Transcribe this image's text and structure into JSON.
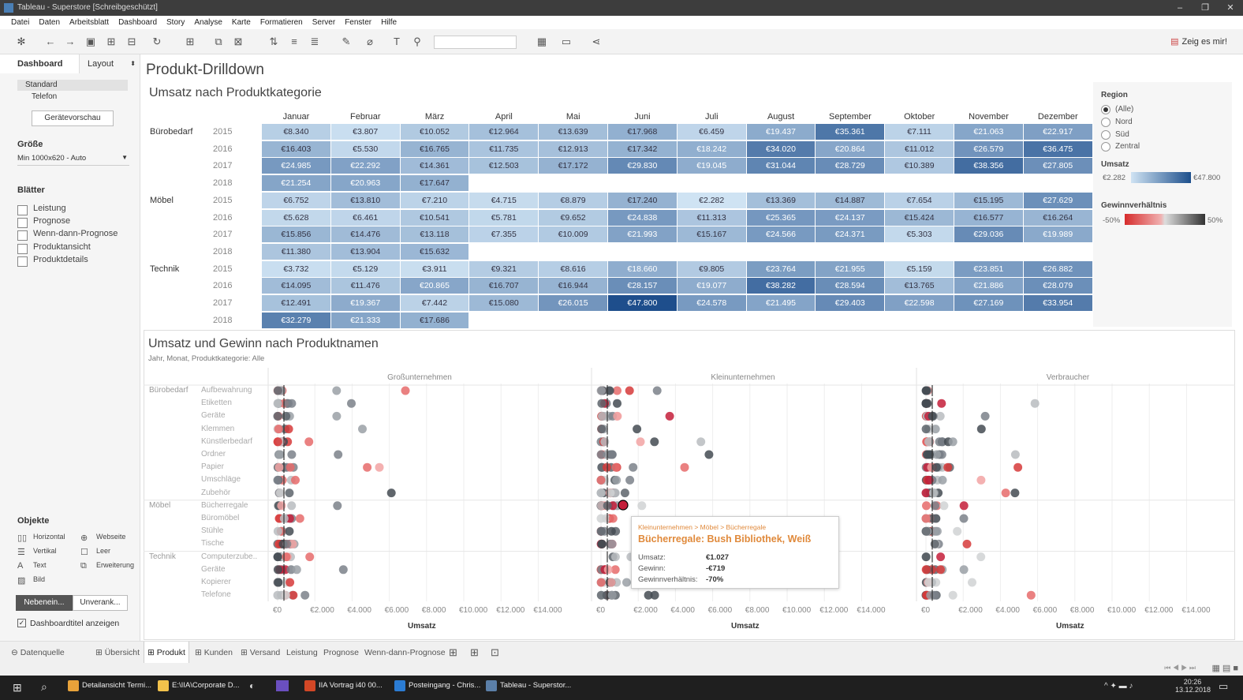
{
  "window": {
    "title": "Tableau - Superstore [Schreibgeschützt]"
  },
  "menu": [
    "Datei",
    "Daten",
    "Arbeitsblatt",
    "Dashboard",
    "Story",
    "Analyse",
    "Karte",
    "Formatieren",
    "Server",
    "Fenster",
    "Hilfe"
  ],
  "toolbar": {
    "show_me": "Zeig es mir!"
  },
  "left": {
    "tab_dashboard": "Dashboard",
    "tab_layout": "Layout",
    "devices": [
      "Standard",
      "Telefon"
    ],
    "preview_btn": "Gerätevorschau",
    "size_title": "Größe",
    "size_value": "Min 1000x620 - Auto",
    "sheets_title": "Blätter",
    "sheets": [
      "Leistung",
      "Prognose",
      "Wenn-dann-Prognose",
      "Produktansicht",
      "Produktdetails"
    ],
    "objects_title": "Objekte",
    "objects": [
      "Horizontal",
      "Webseite",
      "Vertikal",
      "Leer",
      "Text",
      "Erweiterung",
      "Bild"
    ],
    "tiled_btn": "Nebenein...",
    "floating_btn": "Unverank...",
    "show_title_label": "Dashboardtitel anzeigen"
  },
  "dashboard": {
    "title": "Produkt-Drilldown",
    "heatmap_title": "Umsatz nach Produktkategorie",
    "scatter_title": "Umsatz und Gewinn nach Produktnamen",
    "scatter_subtitle": "Jahr, Monat, Produktkategorie: Alle"
  },
  "chart_data": [
    {
      "type": "heatmap",
      "title": "Umsatz nach Produktkategorie",
      "months": [
        "Januar",
        "Februar",
        "März",
        "April",
        "Mai",
        "Juni",
        "Juli",
        "August",
        "September",
        "Oktober",
        "November",
        "Dezember"
      ],
      "rows": [
        {
          "category": "Bürobedarf",
          "year": "2015",
          "values": [
            "€8.340",
            "€3.807",
            "€10.052",
            "€12.964",
            "€13.639",
            "€17.968",
            "€6.459",
            "€19.437",
            "€35.361",
            "€7.111",
            "€21.063",
            "€22.917"
          ]
        },
        {
          "category": "",
          "year": "2016",
          "values": [
            "€16.403",
            "€5.530",
            "€16.765",
            "€11.735",
            "€12.913",
            "€17.342",
            "€18.242",
            "€34.020",
            "€20.864",
            "€11.012",
            "€26.579",
            "€36.475"
          ]
        },
        {
          "category": "",
          "year": "2017",
          "values": [
            "€24.985",
            "€22.292",
            "€14.361",
            "€12.503",
            "€17.172",
            "€29.830",
            "€19.045",
            "€31.044",
            "€28.729",
            "€10.389",
            "€38.356",
            "€27.805"
          ]
        },
        {
          "category": "",
          "year": "2018",
          "values": [
            "€21.254",
            "€20.963",
            "€17.647"
          ]
        },
        {
          "category": "Möbel",
          "year": "2015",
          "values": [
            "€6.752",
            "€13.810",
            "€7.210",
            "€4.715",
            "€8.879",
            "€17.240",
            "€2.282",
            "€13.369",
            "€14.887",
            "€7.654",
            "€15.195",
            "€27.629"
          ]
        },
        {
          "category": "",
          "year": "2016",
          "values": [
            "€5.628",
            "€6.461",
            "€10.541",
            "€5.781",
            "€9.652",
            "€24.838",
            "€11.313",
            "€25.365",
            "€24.137",
            "€15.424",
            "€16.577",
            "€16.264"
          ]
        },
        {
          "category": "",
          "year": "2017",
          "values": [
            "€15.856",
            "€14.476",
            "€13.118",
            "€7.355",
            "€10.009",
            "€21.993",
            "€15.167",
            "€24.566",
            "€24.371",
            "€5.303",
            "€29.036",
            "€19.989"
          ]
        },
        {
          "category": "",
          "year": "2018",
          "values": [
            "€11.380",
            "€13.904",
            "€15.632"
          ]
        },
        {
          "category": "Technik",
          "year": "2015",
          "values": [
            "€3.732",
            "€5.129",
            "€3.911",
            "€9.321",
            "€8.616",
            "€18.660",
            "€9.805",
            "€23.764",
            "€21.955",
            "€5.159",
            "€23.851",
            "€26.882"
          ]
        },
        {
          "category": "",
          "year": "2016",
          "values": [
            "€14.095",
            "€11.476",
            "€20.865",
            "€16.707",
            "€16.944",
            "€28.157",
            "€19.077",
            "€38.282",
            "€28.594",
            "€13.765",
            "€21.886",
            "€28.079"
          ]
        },
        {
          "category": "",
          "year": "2017",
          "values": [
            "€12.491",
            "€19.367",
            "€7.442",
            "€15.080",
            "€26.015",
            "€47.800",
            "€24.578",
            "€21.495",
            "€29.403",
            "€22.598",
            "€27.169",
            "€33.954"
          ]
        },
        {
          "category": "",
          "year": "2018",
          "values": [
            "€32.279",
            "€21.333",
            "€17.686"
          ]
        }
      ]
    },
    {
      "type": "scatter",
      "title": "Umsatz und Gewinn nach Produktnamen",
      "segments": [
        "Großunternehmen",
        "Kleinunternehmen",
        "Verbraucher"
      ],
      "categories": [
        {
          "name": "Bürobedarf",
          "subs": [
            "Aufbewahrung",
            "Etiketten",
            "Geräte",
            "Klemmen",
            "Künstlerbedarf",
            "Ordner",
            "Papier",
            "Umschläge",
            "Zubehör"
          ]
        },
        {
          "name": "Möbel",
          "subs": [
            "Bücherregale",
            "Büromöbel",
            "Stühle",
            "Tische"
          ]
        },
        {
          "name": "Technik",
          "subs": [
            "Computerzube..",
            "Geräte",
            "Kopierer",
            "Telefone"
          ]
        }
      ],
      "x_ticks": [
        "€0",
        "€2.000",
        "€4.000",
        "€6.000",
        "€8.000",
        "€10.000",
        "€12.000",
        "€14.000"
      ],
      "xlabel": "Umsatz"
    }
  ],
  "legend": {
    "region_title": "Region",
    "regions": [
      "(Alle)",
      "Nord",
      "Süd",
      "Zentral"
    ],
    "sales_title": "Umsatz",
    "sales_min": "€2.282",
    "sales_max": "€47.800",
    "profit_title": "Gewinnverhältnis",
    "profit_min": "-50%",
    "profit_max": "50%"
  },
  "tooltip": {
    "path": "Kleinunternehmen > Möbel > Bücherregale",
    "title": "Bücherregale: Bush Bibliothek, Weiß",
    "rows": [
      {
        "label": "Umsatz:",
        "value": "€1.027"
      },
      {
        "label": "Gewinn:",
        "value": "-€719"
      },
      {
        "label": "Gewinnverhältnis:",
        "value": "-70%"
      }
    ]
  },
  "tabs": {
    "datasource": "Datenquelle",
    "items": [
      "Übersicht",
      "Produkt",
      "Kunden",
      "Versand",
      "Leistung",
      "Prognose",
      "Wenn-dann-Prognose"
    ]
  },
  "taskbar": {
    "items": [
      "Detailansicht Termi...",
      "E:\\IIA\\Corporate D...",
      "IIA Vortrag i40 00...",
      "Posteingang - Chris...",
      "Tableau - Superstor..."
    ],
    "time": "20:26",
    "date": "13.12.2018"
  }
}
